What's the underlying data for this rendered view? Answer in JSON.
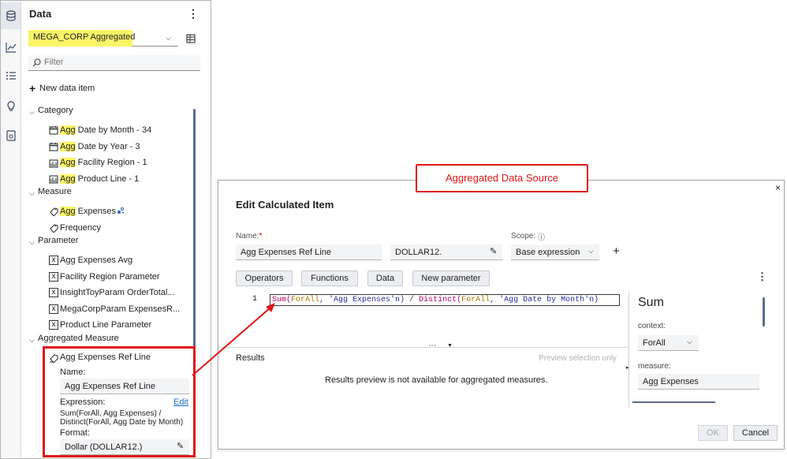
{
  "pane": {
    "title": "Data",
    "data_source": "MEGA_CORP Aggregated",
    "filter_placeholder": "Filter",
    "new_item": "New data item",
    "highlight_prefix": "Agg",
    "categories": {
      "label": "Category",
      "items": [
        {
          "prefix": "Agg",
          "rest": " Date by Month - 34",
          "icon": "calendar-icon"
        },
        {
          "prefix": "Agg",
          "rest": " Date by Year - 3",
          "icon": "calendar-icon"
        },
        {
          "prefix": "Agg",
          "rest": " Facility Region - 1",
          "icon": "category-icon"
        },
        {
          "prefix": "Agg",
          "rest": " Product Line - 1",
          "icon": "category-icon"
        }
      ]
    },
    "measures": {
      "label": "Measure",
      "items": [
        {
          "prefix": "Agg",
          "rest": " Expenses",
          "icon": "measure-icon"
        },
        {
          "prefix": "",
          "rest": "Frequency",
          "icon": "measure-icon"
        }
      ]
    },
    "parameters": {
      "label": "Parameter",
      "items": [
        "Agg Expenses Avg",
        "Facility Region Parameter",
        "InsightToyParam OrderTotal...",
        "MegaCorpParam ExpensesR...",
        "Product Line Parameter"
      ]
    },
    "aggregated_measures": {
      "label": "Aggregated Measure",
      "item": "Agg Expenses Ref Line",
      "name_label": "Name:",
      "name_value": "Agg Expenses Ref Line",
      "expression_label": "Expression:",
      "edit_link": "Edit",
      "expression_line1": "Sum(ForAll, Agg Expenses) /",
      "expression_line2": "Distinct(ForAll, Agg Date by Month)",
      "format_label": "Format:",
      "format_value": "Dollar (DOLLAR12.)"
    }
  },
  "callout": "Aggregated Data Source",
  "dialog": {
    "title": "Edit Calculated Item",
    "close": "×",
    "name_label": "Name:",
    "required_mark": "*",
    "name_value": "Agg Expenses Ref Line",
    "format_value": "DOLLAR12.",
    "scope_label": "Scope:",
    "scope_value": "Base expression",
    "add": "+",
    "buttons": [
      "Operators",
      "Functions",
      "Data",
      "New parameter"
    ],
    "more": "⋮",
    "line_number": "1",
    "expression": {
      "p1": "Sum(",
      "p2": "ForAll",
      "p3": ", ",
      "p4": "'Agg Expenses'n",
      "p5": ") / ",
      "p6": "Distinct(",
      "p7": "ForAll",
      "p8": ", ",
      "p9": "'Agg Date by Month'n",
      "p10": ")"
    },
    "results_label": "Results",
    "preview_only": "Preview selection only",
    "results_message": "Results preview is not available for aggregated measures.",
    "side": {
      "function_name": "Sum",
      "context_label": "context:",
      "context_value": "ForAll",
      "measure_label": "measure:",
      "measure_value": "Agg Expenses"
    },
    "ok": "OK",
    "cancel": "Cancel"
  },
  "colors": {
    "highlight": "#fbf568",
    "callout_red": "#e01616",
    "link": "#1a6fc4"
  }
}
